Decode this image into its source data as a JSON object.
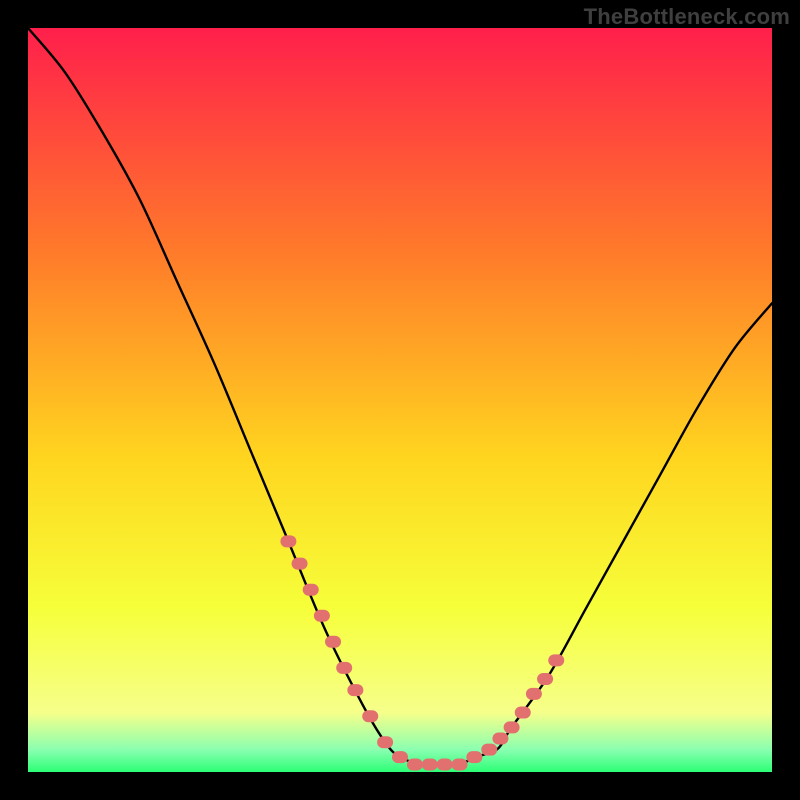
{
  "watermark": "TheBottleneck.com",
  "colors": {
    "background": "#000000",
    "gradient_top": "#ff1f4b",
    "gradient_upper_mid": "#ff7a2a",
    "gradient_mid": "#ffd61f",
    "gradient_lower_mid": "#f6ff3a",
    "gradient_green_band": "#2cff76",
    "curve_stroke": "#000000",
    "marker_fill": "#e2706f"
  },
  "chart_data": {
    "type": "line",
    "title": "",
    "xlabel": "",
    "ylabel": "",
    "xlim": [
      0,
      100
    ],
    "ylim": [
      0,
      100
    ],
    "grid": false,
    "legend": false,
    "series": [
      {
        "name": "bottleneck-curve",
        "x": [
          0,
          5,
          10,
          15,
          20,
          25,
          30,
          35,
          40,
          45,
          48,
          50,
          53,
          55,
          58,
          60,
          63,
          65,
          70,
          75,
          80,
          85,
          90,
          95,
          100
        ],
        "y": [
          100,
          94,
          86,
          77,
          66,
          55,
          43,
          31,
          19,
          9,
          4,
          2,
          1,
          1,
          1,
          2,
          3,
          6,
          13,
          22,
          31,
          40,
          49,
          57,
          63
        ]
      }
    ],
    "markers": {
      "name": "highlighted-points",
      "x": [
        35,
        36.5,
        38,
        39.5,
        41,
        42.5,
        44,
        46,
        48,
        50,
        52,
        54,
        56,
        58,
        60,
        62,
        63.5,
        65,
        66.5,
        68,
        69.5,
        71
      ],
      "y": [
        31,
        28,
        24.5,
        21,
        17.5,
        14,
        11,
        7.5,
        4,
        2,
        1,
        1,
        1,
        1,
        2,
        3,
        4.5,
        6,
        8,
        10.5,
        12.5,
        15
      ]
    }
  }
}
